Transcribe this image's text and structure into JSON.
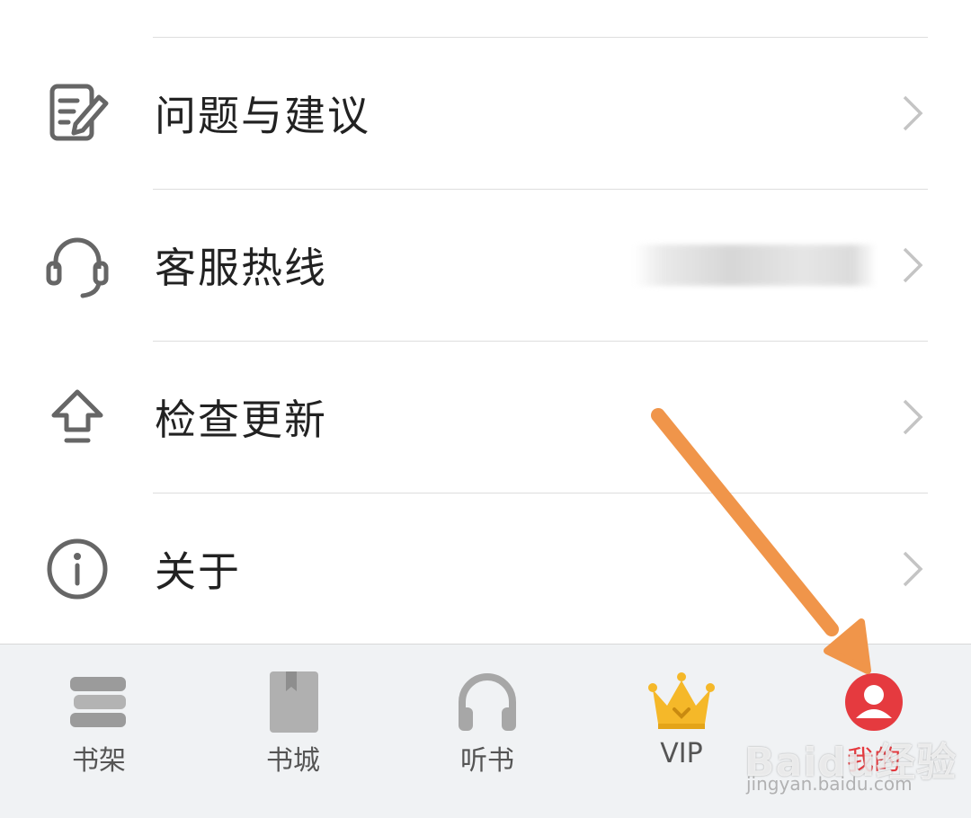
{
  "menu": {
    "items": [
      {
        "label": "问题与建议",
        "icon": "feedback-edit-icon"
      },
      {
        "label": "客服热线",
        "icon": "headset-icon",
        "value_obscured": true
      },
      {
        "label": "检查更新",
        "icon": "upload-arrow-icon"
      },
      {
        "label": "关于",
        "icon": "info-icon"
      }
    ]
  },
  "tabbar": {
    "tabs": [
      {
        "label": "书架",
        "icon": "bookshelf-icon"
      },
      {
        "label": "书城",
        "icon": "bookstore-icon"
      },
      {
        "label": "听书",
        "icon": "headphones-icon"
      },
      {
        "label": "VIP",
        "icon": "crown-icon"
      },
      {
        "label": "我的",
        "icon": "profile-icon",
        "active": true
      }
    ]
  },
  "watermark": {
    "logo_text": "Baidu经验",
    "url_text": "jingyan.baidu.com"
  },
  "colors": {
    "active": "#e53a3f",
    "arrow": "#f0954a",
    "crown": "#f5b829"
  }
}
